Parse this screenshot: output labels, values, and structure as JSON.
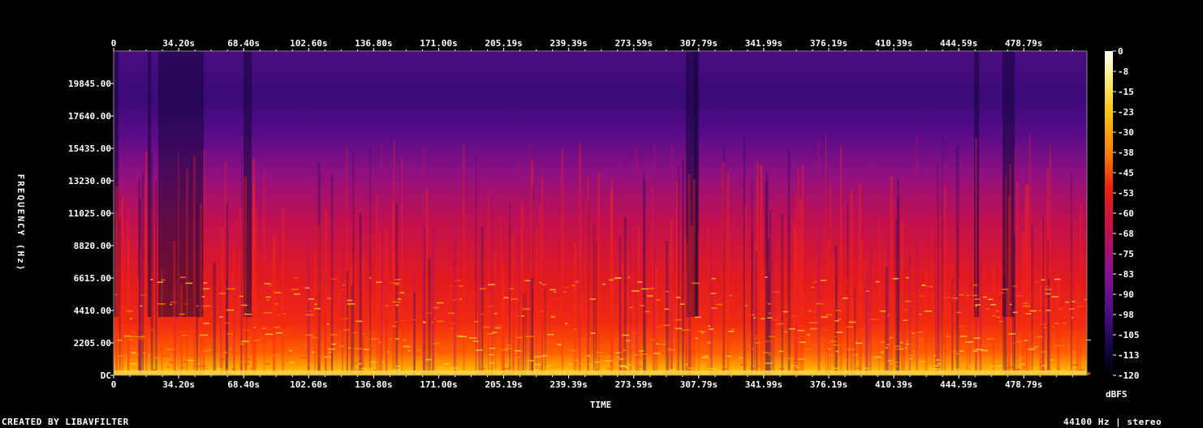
{
  "chart_data": {
    "type": "heatmap",
    "xlabel": "TIME",
    "ylabel": "FREQUENCY (Hz)",
    "x_ticks": [
      "0",
      "34.20s",
      "68.40s",
      "102.60s",
      "136.80s",
      "171.00s",
      "205.19s",
      "239.39s",
      "273.59s",
      "307.79s",
      "341.99s",
      "376.19s",
      "410.39s",
      "444.59s",
      "478.79s"
    ],
    "x_tick_values": [
      0,
      34.2,
      68.4,
      102.6,
      136.8,
      171.0,
      205.19,
      239.39,
      273.59,
      307.79,
      341.99,
      376.19,
      410.39,
      444.59,
      478.79
    ],
    "xlim": [
      0,
      512
    ],
    "y_ticks": [
      "DC",
      "2205.00",
      "4410.00",
      "6615.00",
      "8820.00",
      "11025.00",
      "13230.00",
      "15435.00",
      "17640.00",
      "19845.00"
    ],
    "y_tick_values": [
      0,
      2205,
      4410,
      6615,
      8820,
      11025,
      13230,
      15435,
      17640,
      19845
    ],
    "ylim": [
      0,
      22050
    ],
    "colorbar": {
      "label": "dBFS",
      "ticks": [
        "0",
        "-8",
        "-15",
        "-23",
        "-30",
        "-38",
        "-45",
        "-53",
        "-60",
        "-68",
        "-75",
        "-83",
        "-90",
        "-98",
        "-105",
        "-113",
        "-120"
      ],
      "range": [
        -120,
        0
      ]
    },
    "colors": [
      "#000000",
      "#0d0635",
      "#2a0a6a",
      "#5a0f8a",
      "#8a1090",
      "#c0106a",
      "#e8202a",
      "#ff3a0a",
      "#ff8a00",
      "#ffc800",
      "#fff080",
      "#ffffff"
    ]
  },
  "footer": {
    "left": "CREATED BY LIBAVFILTER",
    "right": "44100 Hz | stereo"
  }
}
